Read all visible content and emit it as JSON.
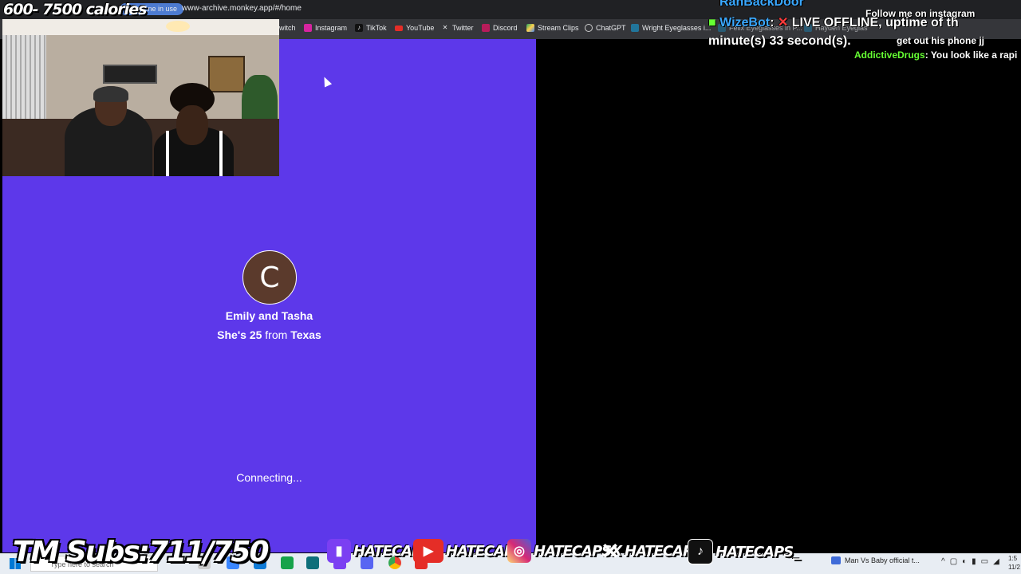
{
  "overlay": {
    "calories": "600- 7500 calories",
    "subs": "TM Subs:711/750",
    "socials": [
      {
        "icon": "twitch-icon",
        "handle": "HATECAPS",
        "color": "#7b3ff2"
      },
      {
        "icon": "youtube-icon",
        "handle": "HATECAPS",
        "color": "#e52d27"
      },
      {
        "icon": "instagram-icon",
        "handle": "HATECAPSX",
        "color": "#d6249f"
      },
      {
        "icon": "x-icon",
        "handle": "HATECAPSS",
        "color": "#111111"
      },
      {
        "icon": "tiktok-icon",
        "handle": "HATECAPS_",
        "color": "#111111"
      }
    ]
  },
  "browser": {
    "mic_status": "crophone in use",
    "url": "www-archive.monkey.app/#/home",
    "bookmarks": [
      {
        "label": "witch",
        "icon": ""
      },
      {
        "label": "Instagram",
        "icon": "instagram-icon"
      },
      {
        "label": "TikTok",
        "icon": "tiktok-icon"
      },
      {
        "label": "YouTube",
        "icon": "youtube-icon"
      },
      {
        "label": "Twitter",
        "icon": "x-icon"
      },
      {
        "label": "Discord",
        "icon": "discord-icon"
      },
      {
        "label": "Stream Clips",
        "icon": "drive-icon"
      },
      {
        "label": "ChatGPT",
        "icon": "chatgpt-icon"
      },
      {
        "label": "Wright Eyeglasses i...",
        "icon": "wp-icon"
      },
      {
        "label": "Felix Eyeglasses in P...",
        "icon": "wp-icon"
      },
      {
        "label": "Hayden Eyeglas",
        "icon": "wp-icon"
      }
    ]
  },
  "match": {
    "avatar_initial": "C",
    "name": "Emily and Tasha",
    "info_prefix": "She's",
    "age": "25",
    "info_from": "from",
    "location": "Texas",
    "status": "Connecting..."
  },
  "chat": {
    "lines": [
      {
        "user": "RanBackDoor",
        "text": ""
      },
      {
        "user": "",
        "text": "Follow me on instagram"
      },
      {
        "user": "WizeBot",
        "text": "LIVE OFFLINE, uptime of th"
      },
      {
        "user": "",
        "text": "minute(s) 33 second(s)."
      },
      {
        "user": "",
        "text": "get out his phone jj"
      },
      {
        "user": "AddictiveDrugs",
        "text": "You look like a rapi"
      }
    ]
  },
  "taskbar": {
    "search_placeholder": "Type here to search",
    "media_title": "Man Vs Baby official t...",
    "clock_time": "1:5",
    "clock_date": "11/2"
  }
}
